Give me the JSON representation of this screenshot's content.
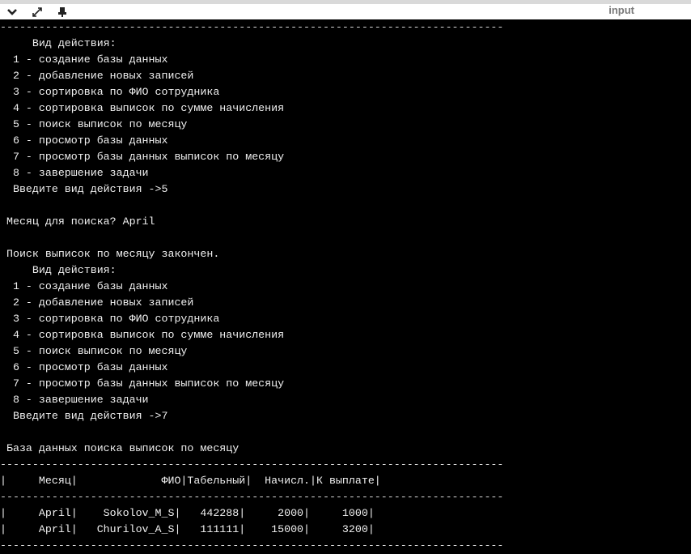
{
  "toolbar": {
    "input_label": "input",
    "icons": [
      "chevron-down-icon",
      "collapse-arrows-icon",
      "pin-icon"
    ]
  },
  "console": {
    "lines": [
      "------------------------------------------------------------------------------",
      "     Вид действия:",
      "  1 - создание базы данных",
      "  2 - добавление новых записей",
      "  3 - сортировка по ФИО сотрудника",
      "  4 - сортировка выписок по сумме начисления",
      "  5 - поиск выписок по месяцу",
      "  6 - просмотр базы данных",
      "  7 - просмотр базы данных выписок по месяцу",
      "  8 - завершение задачи",
      "  Введите вид действия ->5",
      "",
      " Месяц для поиска? April",
      "",
      " Поиск выписок по месяцу закончен.",
      "     Вид действия:",
      "  1 - создание базы данных",
      "  2 - добавление новых записей",
      "  3 - сортировка по ФИО сотрудника",
      "  4 - сортировка выписок по сумме начисления",
      "  5 - поиск выписок по месяцу",
      "  6 - просмотр базы данных",
      "  7 - просмотр базы данных выписок по месяцу",
      "  8 - завершение задачи",
      "  Введите вид действия ->7",
      "",
      " База данных поиска выписок по месяцу",
      "------------------------------------------------------------------------------",
      "|     Месяц|             ФИО|Табельный|  Начисл.|К выплате|",
      "------------------------------------------------------------------------------",
      "",
      "|     April|    Sokolov_M_S|   442288|     2000|     1000|",
      "|     April|   Churilov_A_S|   111111|    15000|     3200|",
      "------------------------------------------------------------------------------"
    ]
  }
}
